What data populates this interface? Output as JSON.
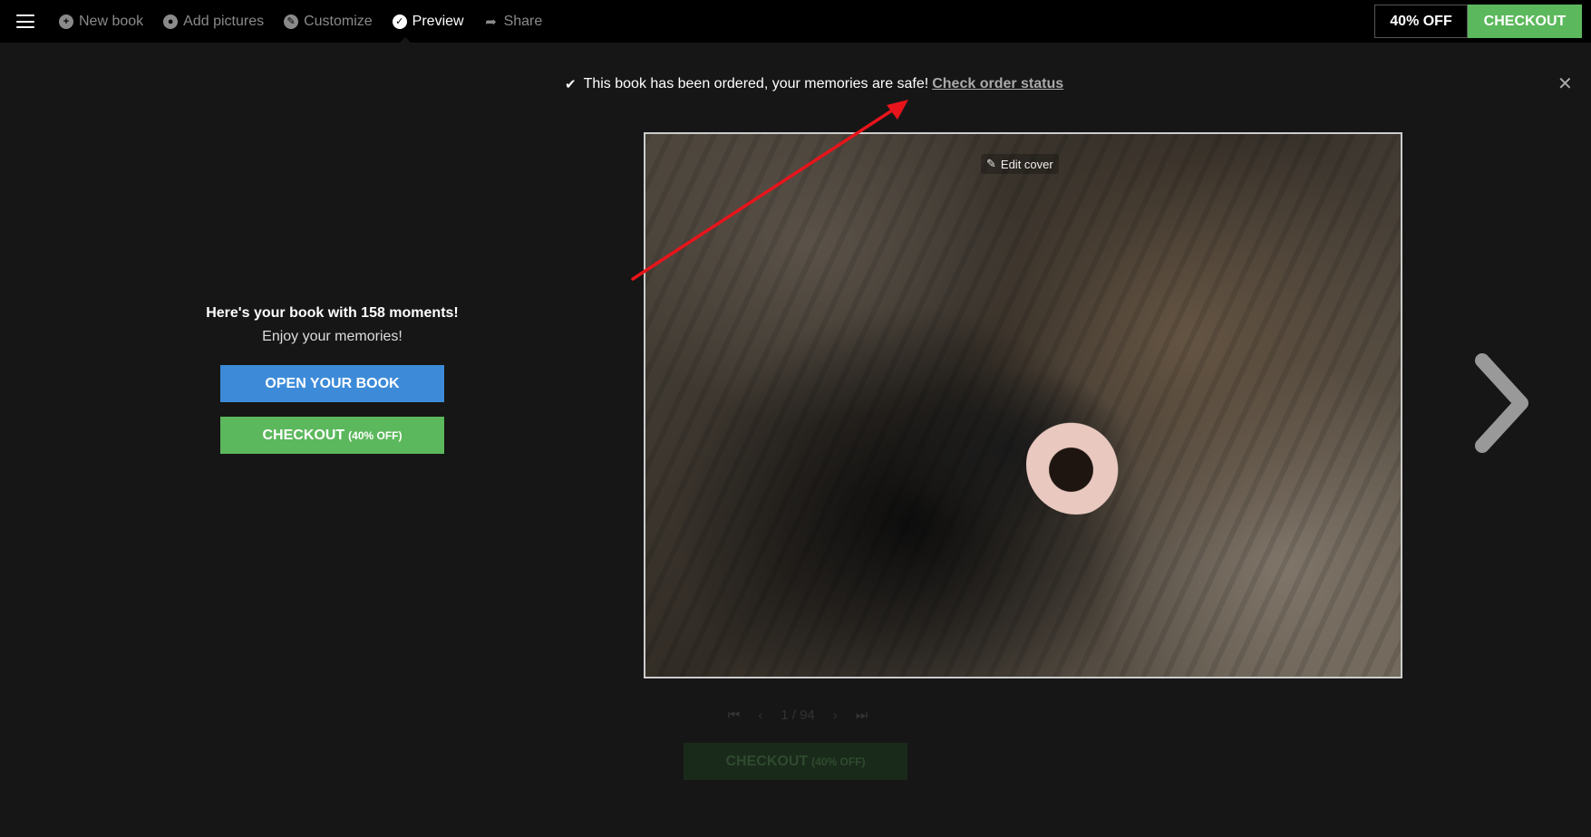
{
  "nav": {
    "items": [
      {
        "label": "New book",
        "icon": "plus-circle-icon",
        "state": "inactive"
      },
      {
        "label": "Add pictures",
        "icon": "camera-icon",
        "state": "inactive"
      },
      {
        "label": "Customize",
        "icon": "brush-icon",
        "state": "inactive"
      },
      {
        "label": "Preview",
        "icon": "check-circle-icon",
        "state": "active"
      },
      {
        "label": "Share",
        "icon": "share-arrow-icon",
        "state": "inactive"
      }
    ],
    "discount_label": "40% OFF",
    "checkout_label": "CHECKOUT"
  },
  "notice": {
    "text": "This book has been ordered, your memories are safe!",
    "link": "Check order status"
  },
  "left_panel": {
    "title": "Here's your book with 158 moments!",
    "subtitle": "Enjoy your memories!",
    "open_label": "OPEN YOUR BOOK",
    "checkout_label": "CHECKOUT",
    "checkout_discount": "(40% OFF)"
  },
  "cover": {
    "edit_label": "Edit cover"
  },
  "pager": {
    "text": "1 / 94"
  },
  "bottom": {
    "checkout_label": "CHECKOUT",
    "checkout_discount": "(40% OFF)"
  },
  "colors": {
    "accent_green": "#5cb85c",
    "accent_blue": "#3d8bd8",
    "annotation_red": "#e8141b"
  }
}
